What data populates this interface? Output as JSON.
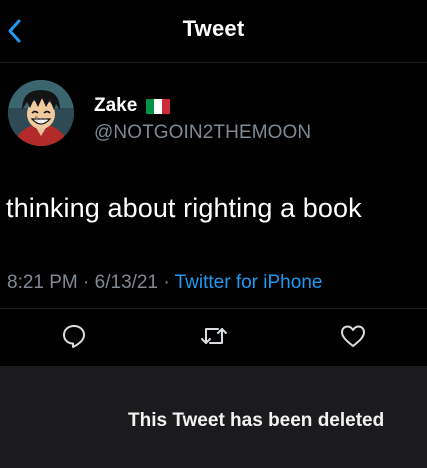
{
  "header": {
    "title": "Tweet",
    "back_icon": "chevron-left-icon",
    "accent": "#1d9bf0"
  },
  "tweet": {
    "author": {
      "display_name": "Zake",
      "flag_icon": "italy-flag-icon",
      "flag_colors": [
        "#009246",
        "#ffffff",
        "#ce2b37"
      ],
      "handle": "@NOTGOIN2THEMOON",
      "avatar_icon": "anime-avatar-icon"
    },
    "text": "thinking about righting a book",
    "time": "8:21 PM",
    "separator": "·",
    "date": "6/13/21",
    "source": "Twitter for iPhone",
    "actions": [
      {
        "icon": "reply-icon"
      },
      {
        "icon": "retweet-icon"
      },
      {
        "icon": "like-icon"
      }
    ]
  },
  "notice": {
    "text": "This Tweet has been deleted"
  },
  "colors": {
    "background": "#000000",
    "text": "#ffffff",
    "secondary_text": "#7f8a95",
    "link": "#1d9bf0",
    "notice_panel": "#1b1b1d"
  }
}
